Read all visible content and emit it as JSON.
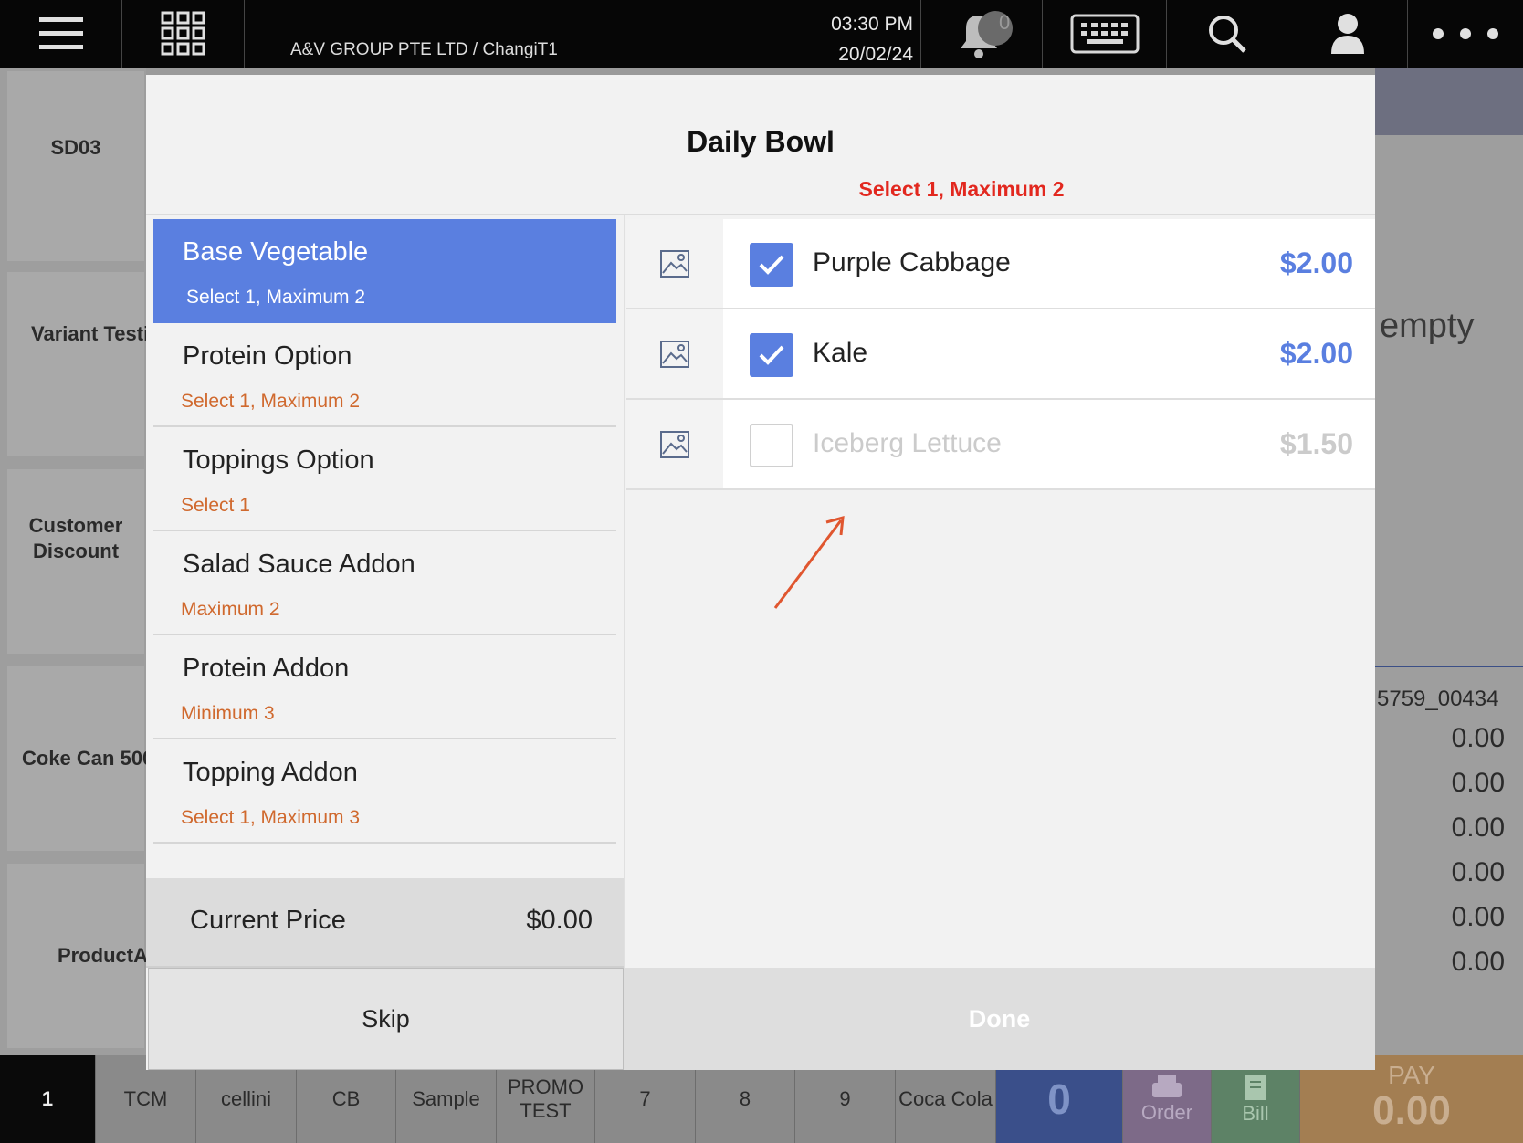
{
  "topbar": {
    "company": "A&V GROUP PTE LTD / ChangiT1",
    "time": "03:30 PM",
    "date": "20/02/24",
    "notification_count": "0",
    "icons": [
      "hamburger-menu-icon",
      "apps-grid-icon",
      "bell-icon",
      "keyboard-icon",
      "search-icon",
      "user-icon",
      "more-dots-icon"
    ]
  },
  "background": {
    "left_tiles": [
      "SD03",
      "Variant Testi",
      "Customer\nDiscount",
      "Coke Can 500",
      "ProductA"
    ],
    "right_panel": {
      "empty_text": "empty",
      "order_id": "5759_00434",
      "values": [
        "0.00",
        "0.00",
        "0.00",
        "0.00",
        "0.00",
        "0.00"
      ]
    },
    "bottom_bar": {
      "table": "1",
      "items": [
        "TCM",
        "cellini",
        "CB",
        "Sample",
        "PROMO\nTEST",
        "7",
        "8",
        "9",
        "Coca Cola"
      ],
      "count": "0",
      "order_label": "Order",
      "bill_label": "Bill",
      "pay_label": "PAY",
      "pay_amount": "0.00"
    }
  },
  "modal": {
    "title": "Daily Bowl",
    "subtitle": "Select 1, Maximum 2",
    "groups": [
      {
        "name": "Base Vegetable",
        "rule": "Select 1, Maximum  2",
        "active": true
      },
      {
        "name": "Protein Option",
        "rule": "Select 1, Maximum  2",
        "active": false
      },
      {
        "name": "Toppings Option",
        "rule": "Select 1",
        "active": false
      },
      {
        "name": "Salad Sauce Addon",
        "rule": "Maximum 2",
        "active": false
      },
      {
        "name": "Protein Addon",
        "rule": "Minimum 3",
        "active": false
      },
      {
        "name": "Topping Addon",
        "rule": "Select 1, Maximum 3",
        "active": false
      }
    ],
    "options": [
      {
        "name": "Purple Cabbage",
        "price": "$2.00",
        "checked": true,
        "disabled": false
      },
      {
        "name": "Kale",
        "price": "$2.00",
        "checked": true,
        "disabled": false
      },
      {
        "name": "Iceberg Lettuce",
        "price": "$1.50",
        "checked": false,
        "disabled": true
      }
    ],
    "current_price_label": "Current Price",
    "current_price_value": "$0.00",
    "skip_label": "Skip",
    "done_label": "Done"
  },
  "colors": {
    "accent": "#5a7fe0",
    "rule_text": "#d0692e",
    "subtitle": "#e2281f",
    "annotation_arrow": "#e0562f"
  }
}
